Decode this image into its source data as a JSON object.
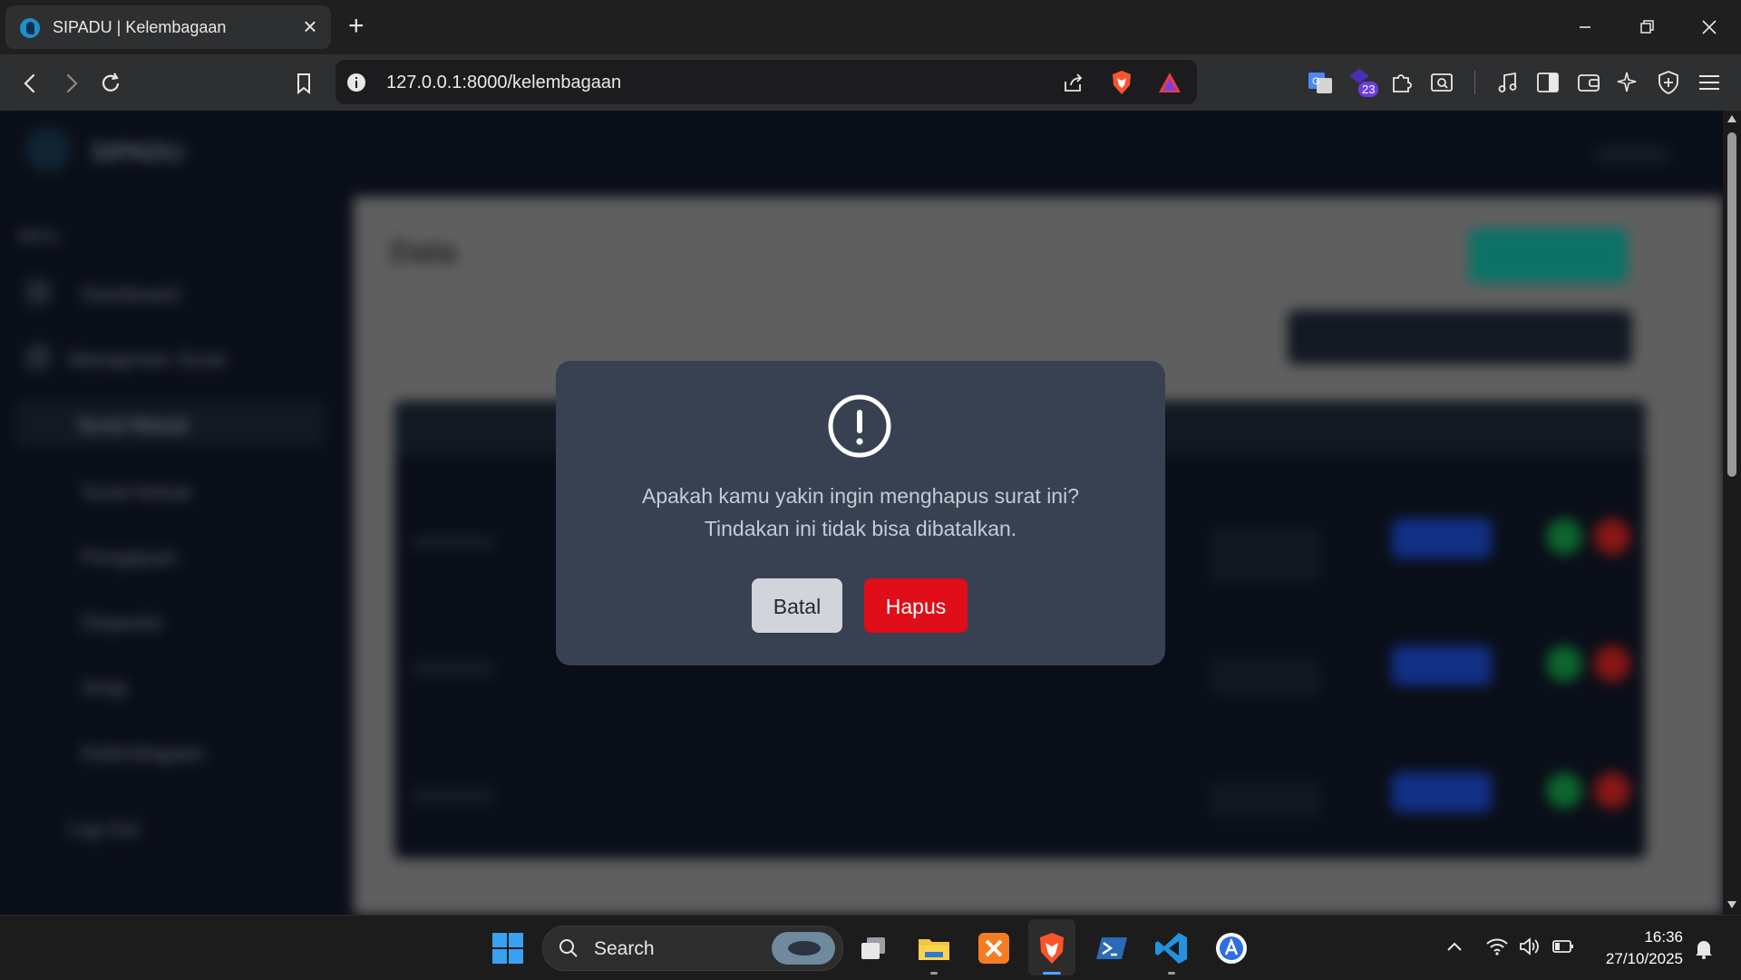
{
  "browser": {
    "tab_title": "SIPADU | Kelembagaan",
    "url": "127.0.0.1:8000/kelembagaan",
    "notification_badge": "23"
  },
  "page": {
    "brand": "SIPADU",
    "sidebar_section": "Menu",
    "sidebar_items": [
      "Dashboard",
      "Manajemen Surat",
      "Surat Masuk",
      "Surat Keluar",
      "Pengajuan",
      "Disposisi",
      "Arsip",
      "Kelembagaan"
    ],
    "logout": "Log Out",
    "title": "Data"
  },
  "modal": {
    "message_line1": "Apakah kamu yakin ingin menghapus surat ini?",
    "message_line2": "Tindakan ini tidak bisa dibatalkan.",
    "cancel_label": "Batal",
    "delete_label": "Hapus",
    "icon": "alert-circle-icon"
  },
  "taskbar": {
    "search_label": "Search",
    "time": "16:36",
    "date": "27/10/2025"
  },
  "colors": {
    "modal_bg": "#374151",
    "delete_button": "#e00e18",
    "cancel_button": "#d1d5db",
    "page_bg": "#111827",
    "accent_teal": "#14b8a6"
  }
}
